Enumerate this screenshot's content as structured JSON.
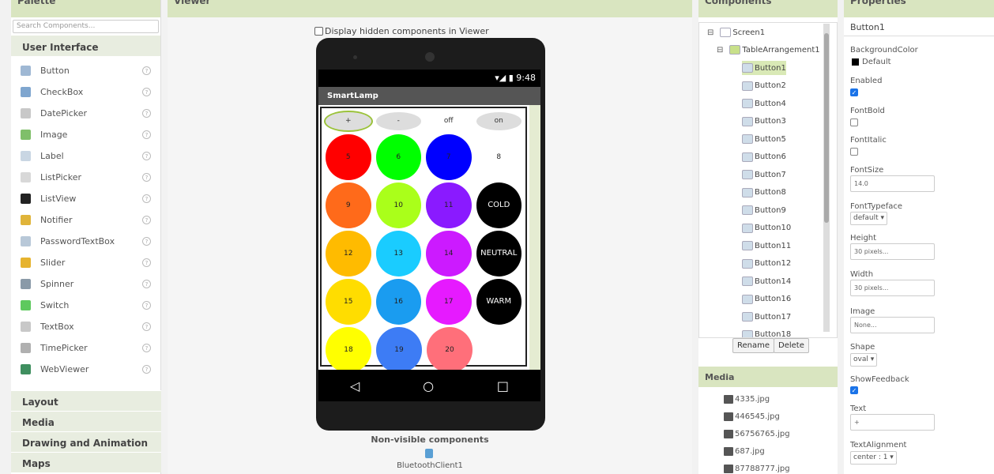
{
  "headers": {
    "palette": "Palette",
    "viewer": "Viewer",
    "components": "Components",
    "properties": "Properties"
  },
  "palette": {
    "search_placeholder": "Search Components...",
    "open_category": "User Interface",
    "items": [
      {
        "label": "Button",
        "icon": "button-icon",
        "color": "#9fb8d4"
      },
      {
        "label": "CheckBox",
        "icon": "checkbox-icon",
        "color": "#7fa6cf"
      },
      {
        "label": "DatePicker",
        "icon": "calendar-icon",
        "color": "#c8c8c8"
      },
      {
        "label": "Image",
        "icon": "image-icon",
        "color": "#7fbf6a"
      },
      {
        "label": "Label",
        "icon": "label-icon",
        "color": "#c9d6e3"
      },
      {
        "label": "ListPicker",
        "icon": "listpicker-icon",
        "color": "#d8d8d8"
      },
      {
        "label": "ListView",
        "icon": "list-icon",
        "color": "#222222"
      },
      {
        "label": "Notifier",
        "icon": "warning-icon",
        "color": "#e0b43a"
      },
      {
        "label": "PasswordTextBox",
        "icon": "password-icon",
        "color": "#b8c8d8"
      },
      {
        "label": "Slider",
        "icon": "slider-icon",
        "color": "#e6b32e"
      },
      {
        "label": "Spinner",
        "icon": "spinner-icon",
        "color": "#8a9aa8"
      },
      {
        "label": "Switch",
        "icon": "switch-icon",
        "color": "#5ec95e"
      },
      {
        "label": "TextBox",
        "icon": "textbox-icon",
        "color": "#c8c8c8"
      },
      {
        "label": "TimePicker",
        "icon": "clock-icon",
        "color": "#b0b0b0"
      },
      {
        "label": "WebViewer",
        "icon": "globe-icon",
        "color": "#3f8f5f"
      }
    ],
    "categories": [
      "Layout",
      "Media",
      "Drawing and Animation",
      "Maps"
    ]
  },
  "viewer": {
    "hidden_checkbox_label": "Display hidden components in Viewer",
    "status_time": "9:48",
    "app_title": "SmartLamp",
    "top_buttons": [
      "+",
      "-",
      "off",
      "on"
    ],
    "rows": [
      [
        {
          "t": "5",
          "c": "#ff0000"
        },
        {
          "t": "6",
          "c": "#00ff00"
        },
        {
          "t": "7",
          "c": "#0000ff"
        },
        {
          "t": "8",
          "c": "#ffffff"
        }
      ],
      [
        {
          "t": "9",
          "c": "#ff6a1a"
        },
        {
          "t": "10",
          "c": "#aaff1a"
        },
        {
          "t": "11",
          "c": "#8a1aff"
        },
        {
          "t": "COLD",
          "c": "#000000"
        }
      ],
      [
        {
          "t": "12",
          "c": "#ffbb00"
        },
        {
          "t": "13",
          "c": "#1accff"
        },
        {
          "t": "14",
          "c": "#cc1aff"
        },
        {
          "t": "NEUTRAL",
          "c": "#000000"
        }
      ],
      [
        {
          "t": "15",
          "c": "#ffdd00"
        },
        {
          "t": "16",
          "c": "#1a9cf0"
        },
        {
          "t": "17",
          "c": "#e61aff"
        },
        {
          "t": "WARM",
          "c": "#000000"
        }
      ],
      [
        {
          "t": "18",
          "c": "#ffff00"
        },
        {
          "t": "19",
          "c": "#3d7cf5"
        },
        {
          "t": "20",
          "c": "#ff6f7a"
        }
      ]
    ],
    "non_visible_title": "Non-visible components",
    "non_visible_item": "BluetoothClient1"
  },
  "components": {
    "screen": "Screen1",
    "arrangement": "TableArrangement1",
    "buttons": [
      "Button1",
      "Button2",
      "Button4",
      "Button3",
      "Button5",
      "Button6",
      "Button7",
      "Button8",
      "Button9",
      "Button10",
      "Button11",
      "Button12",
      "Button14",
      "Button16",
      "Button17",
      "Button18"
    ],
    "rename": "Rename",
    "delete": "Delete",
    "media_title": "Media",
    "media": [
      "4335.jpg",
      "446545.jpg",
      "56756765.jpg",
      "687.jpg",
      "87788777.jpg"
    ]
  },
  "properties": {
    "component": "Button1",
    "bg_label": "BackgroundColor",
    "bg_value": "Default",
    "enabled_label": "Enabled",
    "fontbold_label": "FontBold",
    "fontitalic_label": "FontItalic",
    "fontsize_label": "FontSize",
    "fontsize_value": "14.0",
    "typeface_label": "FontTypeface",
    "typeface_value": "default ▾",
    "height_label": "Height",
    "height_value": "30 pixels...",
    "width_label": "Width",
    "width_value": "30 pixels...",
    "image_label": "Image",
    "image_value": "None...",
    "shape_label": "Shape",
    "shape_value": "oval ▾",
    "feedback_label": "ShowFeedback",
    "text_label": "Text",
    "text_value": "+",
    "align_label": "TextAlignment",
    "align_value": "center : 1 ▾"
  }
}
